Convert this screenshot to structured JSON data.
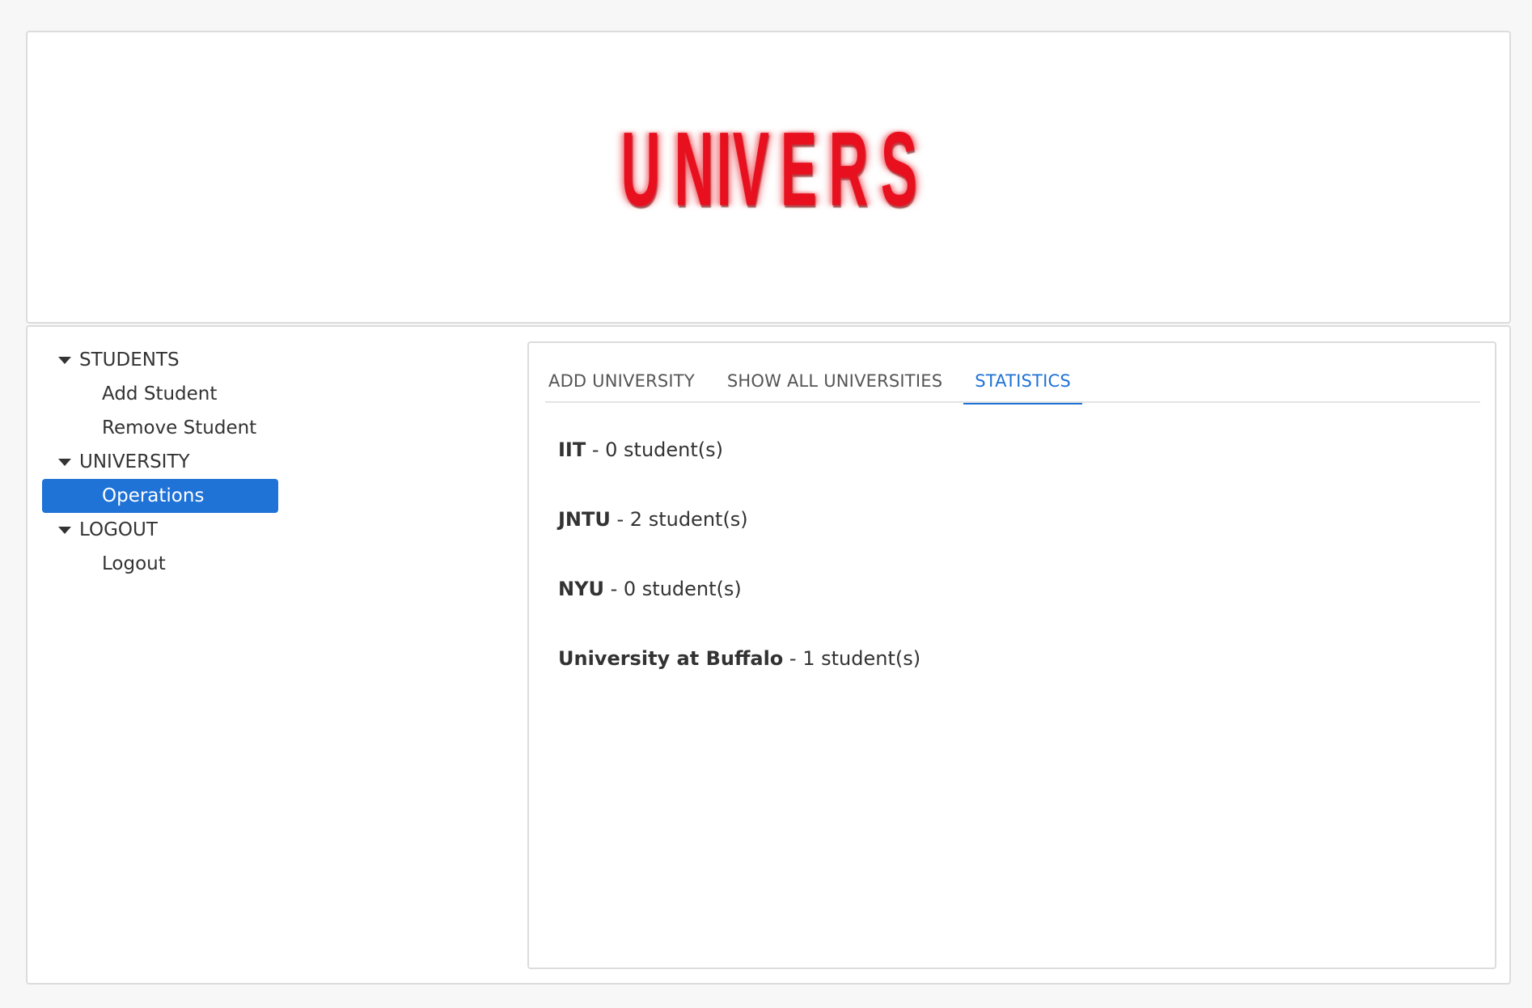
{
  "logo": {
    "letters": [
      "U",
      "N",
      "I",
      "V",
      "E",
      "R",
      "S"
    ],
    "color": "#e8101e"
  },
  "sidebar": {
    "groups": [
      {
        "label": "STUDENTS",
        "items": [
          {
            "label": "Add Student"
          },
          {
            "label": "Remove Student"
          }
        ]
      },
      {
        "label": "UNIVERSITY",
        "items": [
          {
            "label": "Operations",
            "selected": true
          }
        ]
      },
      {
        "label": "LOGOUT",
        "items": [
          {
            "label": "Logout"
          }
        ]
      }
    ],
    "selected_color": "#1f72d6"
  },
  "tabs": [
    {
      "label": "ADD UNIVERSITY"
    },
    {
      "label": "SHOW ALL UNIVERSITIES"
    },
    {
      "label": "STATISTICS",
      "active": true
    }
  ],
  "stats": [
    {
      "name": "IIT",
      "separator": " - ",
      "count": "0 student(s)"
    },
    {
      "name": "JNTU",
      "separator": " - ",
      "count": "2 student(s)"
    },
    {
      "name": "NYU",
      "separator": " - ",
      "count": "0 student(s)"
    },
    {
      "name": "University at Buffalo",
      "separator": " - ",
      "count": "1 student(s)"
    }
  ],
  "accent_color": "#1f72d6"
}
